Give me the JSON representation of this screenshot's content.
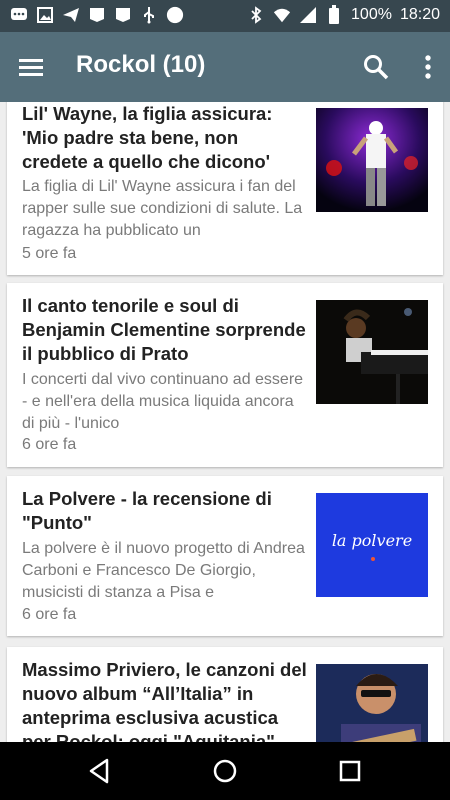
{
  "status_bar": {
    "battery": "100%",
    "time": "18:20",
    "icons": [
      "chat-icon",
      "image-icon",
      "send-icon",
      "notification-icon",
      "notification-icon-2",
      "usb-icon",
      "circle-icon",
      "bluetooth-icon",
      "wifi-icon",
      "signal-icon",
      "battery-icon"
    ]
  },
  "app_bar": {
    "title": "Rockol (10)",
    "icons": [
      "menu-icon",
      "search-icon",
      "more-vert-icon"
    ],
    "color": "#546e7a",
    "status_color": "#37474f"
  },
  "articles": [
    {
      "title": "Lil' Wayne, la figlia assicura: 'Mio padre sta bene, non credete a quello che dicono'",
      "description": "La figlia di Lil' Wayne assicura i fan del rapper sulle sue condizioni di salute. La ragazza ha pubblicato un",
      "time": "5 ore fa"
    },
    {
      "title": "Il canto tenorile e soul di Benjamin Clementine sorprende il pubblico di Prato",
      "description": "I concerti dal vivo continuano ad essere - e nell'era della musica liquida ancora di più - l'unico",
      "time": "6 ore fa"
    },
    {
      "title": "La Polvere - la recensione di \"Punto\"",
      "description": "La polvere è il nuovo progetto di Andrea Carboni e Francesco De Giorgio, musicisti di stanza a Pisa e",
      "time": "6 ore fa",
      "thumb_text": "la polvere"
    },
    {
      "title": "Massimo Priviero, le canzoni del nuovo album “All’Italia” in anteprima esclusiva acustica per Rockol: oggi \"Aquitania\"",
      "description": "",
      "time": ""
    }
  ],
  "nav_bar": {
    "icons": [
      "back-icon",
      "home-icon",
      "recents-icon"
    ]
  }
}
